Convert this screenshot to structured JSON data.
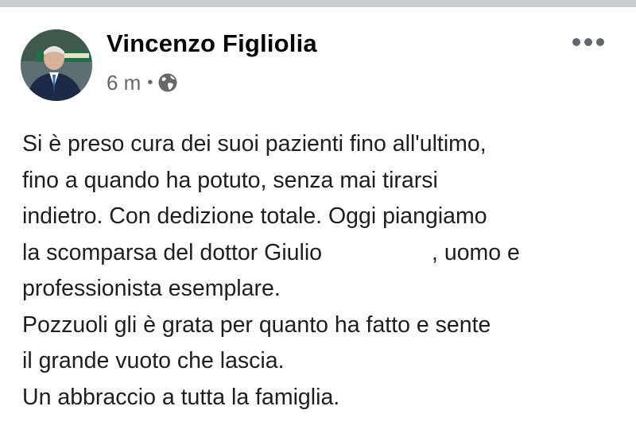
{
  "post": {
    "author": "Vincenzo Figliolia",
    "time": "6 m",
    "separator": "•",
    "privacy_icon": "globe-icon",
    "more_icon": "more-options-icon",
    "text_lines": [
      "Si è preso cura dei suoi pazienti fino all'ultimo,",
      "fino a quando ha potuto, senza mai tirarsi",
      "indietro. Con dedizione totale. Oggi piangiamo"
    ],
    "line4_before": "la scomparsa del dottor Giulio",
    "line4_after": ", uomo e",
    "text_lines_end": [
      "professionista esemplare.",
      "Pozzuoli gli è grata per quanto ha fatto e sente",
      "il grande vuoto che lascia.",
      "Un abbraccio a tutta la famiglia."
    ]
  },
  "colors": {
    "background": "#ffffff",
    "top_band": "#c9ccd1",
    "text": "#1c1e21",
    "secondary_text": "#65676b"
  }
}
